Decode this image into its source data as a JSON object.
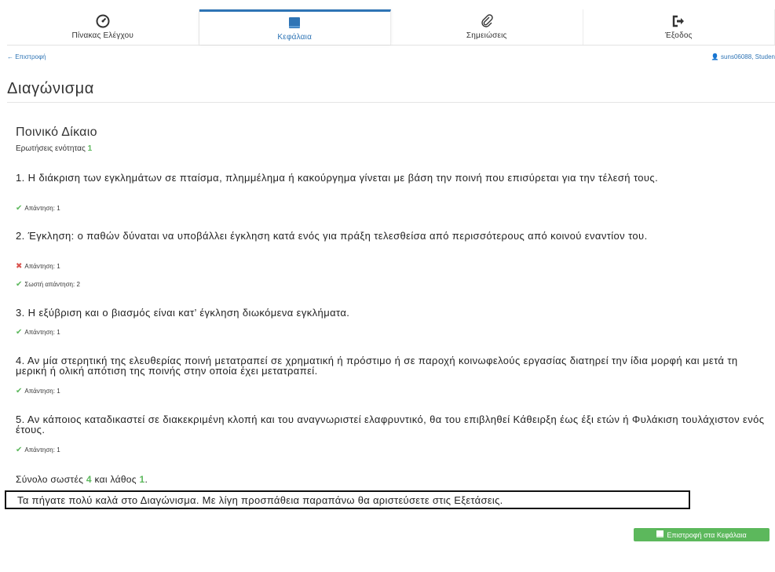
{
  "nav": {
    "tabs": [
      {
        "label": "Πίνακας Ελέγχου",
        "icon": "dashboard-icon"
      },
      {
        "label": "Κεφάλαια",
        "icon": "book-icon",
        "active": true
      },
      {
        "label": "Σημειώσεις",
        "icon": "paperclip-icon"
      },
      {
        "label": "Έξοδος",
        "icon": "sign-out-icon"
      }
    ]
  },
  "back_link": "← Επιστροφή",
  "user": "suns06088, Studen",
  "page_title": "Διαγώνισμα",
  "section": {
    "title": "Ποινικό Δίκαιο",
    "unit_questions_label": "Ερωτήσεις ενότητας",
    "unit_questions_value": "1"
  },
  "questions": [
    {
      "text": "1. Η διάκριση των εγκλημάτων σε πταίσμα, πλημμέλημα ή κακούργημα γίνεται με βάση την ποινή που επισύρεται για την τέλεσή τους.",
      "answer": "Απάντηση: 1"
    },
    {
      "text": "2. Έγκληση: ο παθών δύναται να υποβάλλει έγκληση κατά ενός για πράξη τελεσθείσα από περισσότερους από κοινού εναντίον του.",
      "answer": "Απάντηση: 1",
      "correct_answer": "Σωστή απάντηση: 2"
    },
    {
      "text": "3. Η εξύβριση και ο βιασμός είναι κατ’ έγκληση διωκόμενα εγκλήματα.",
      "answer": "Απάντηση: 1"
    },
    {
      "text": "4. Αν μία στερητική της ελευθερίας ποινή μετατραπεί σε χρηματική ή πρόστιμο ή σε παροχή κοινωφελούς εργασίας διατηρεί την ίδια μορφή και μετά τη μερική ή ολική απότιση της ποινής στην οποία έχει μετατραπεί.",
      "answer": "Απάντηση: 1"
    },
    {
      "text": "5. Αν κάποιος καταδικαστεί σε διακεκριμένη κλοπή και του αναγνωριστεί ελαφρυντικό, θα του επιβληθεί Κάθειρξη έως έξι ετών ή Φυλάκιση τουλάχιστον ενός έτους.",
      "answer": "Απάντηση: 1"
    }
  ],
  "summary": {
    "prefix": "Σύνολο σωστές",
    "correct": "4",
    "middle": "και λάθος",
    "wrong": "1",
    "suffix": "."
  },
  "feedback": "Τα πήγατε πολύ καλά στο Διαγώνισμα. Με λίγη προσπάθεια παραπάνω θα αριστεύσετε στις Εξετάσεις.",
  "return_button": "Επιστροφή στα Κεφάλαια",
  "colors": {
    "accent": "#2e74b5",
    "success": "#5cb85c",
    "error": "#d9534f"
  }
}
